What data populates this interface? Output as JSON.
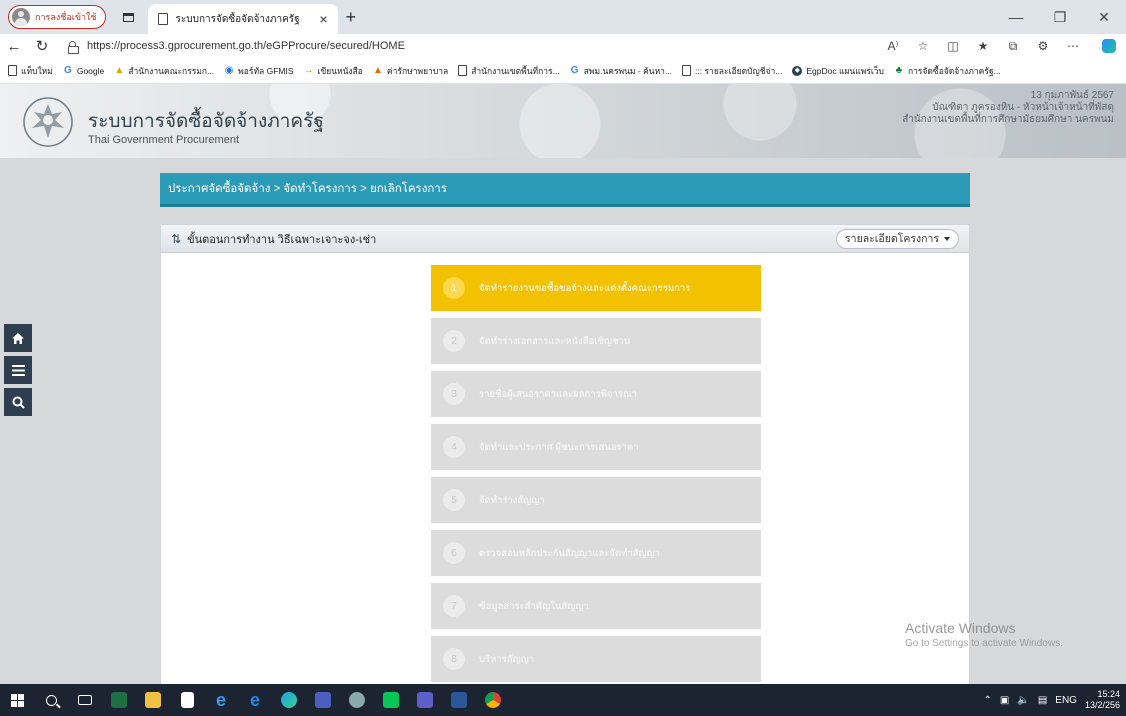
{
  "browser": {
    "profile_label": "การลงชื่อเข้าใช้",
    "tab_title": "ระบบการจัดซื้อจัดจ้างภาครัฐ",
    "url": "https://process3.gprocurement.go.th/eGPProcure/secured/HOME",
    "new_tab": "+",
    "tab_close": "×"
  },
  "bookmarks": [
    {
      "label": "แท็บใหม่",
      "icon": "folder"
    },
    {
      "label": "Google",
      "icon": "google-icon"
    },
    {
      "label": "สำนักงานคณะกรรมก...",
      "icon": "bookmark-icon"
    },
    {
      "label": "พอร์ทัล GFMIS",
      "icon": "gfmis-icon"
    },
    {
      "label": "เขียนหนังสือ",
      "icon": "bookmark-icon"
    },
    {
      "label": "ค่ารักษาพยาบาล",
      "icon": "bookmark-icon"
    },
    {
      "label": "สำนักงานเขตพื้นที่การ...",
      "icon": "folder"
    },
    {
      "label": "สพม.นครพนม - ค้นหา...",
      "icon": "google-icon"
    },
    {
      "label": "::: รายละเอียดบัญชีจ่า...",
      "icon": "folder"
    },
    {
      "label": "EgpDoc แผนแพร่เว็บ",
      "icon": "egpdoc-icon"
    },
    {
      "label": "การจัดซื้อจัดจ้างภาครัฐ...",
      "icon": "egp-icon"
    }
  ],
  "header": {
    "site_name": "ระบบการจัดซื้อจัดจ้างภาครัฐ",
    "site_sub": "Thai Government Procurement",
    "date": "13 กุมภาพันธ์ 2567",
    "user": "บัณฑิตา ภูครองหิน - หัวหน้าเจ้าหน้าที่พัสดุ",
    "office": "สำนักงานเขตพื้นที่การศึกษามัธยมศึกษา นครพนม"
  },
  "breadcrumb": "ประกาศจัดซื้อจัดจ้าง > จัดทำโครงการ > ยกเลิกโครงการ",
  "panel": {
    "title": "ขั้นตอนการทำงาน วิธีเฉพาะเจาะจง-เช่า",
    "detail_button": "รายละเอียดโครงการ"
  },
  "steps": [
    {
      "num": "1",
      "label": "จัดทำรายงานขอซื้อขอจ้างและแต่งตั้งคณะกรรมการ",
      "active": true
    },
    {
      "num": "2",
      "label": "จัดทำร่างเอกสารและหนังสือเชิญชวน",
      "active": false
    },
    {
      "num": "3",
      "label": "รายชื่อผู้เสนอราคาและผลการพิจารณา",
      "active": false
    },
    {
      "num": "4",
      "label": "จัดทำและประกาศ ผู้ชนะการเสนอราคา",
      "active": false
    },
    {
      "num": "5",
      "label": "จัดทำร่างสัญญา",
      "active": false
    },
    {
      "num": "6",
      "label": "ตรวจสอบหลักประกันสัญญาและจัดทำสัญญา",
      "active": false
    },
    {
      "num": "7",
      "label": "ข้อมูลสาระสำคัญในสัญญา",
      "active": false
    },
    {
      "num": "8",
      "label": "บริหารสัญญา",
      "active": false
    }
  ],
  "watermark": {
    "title": "Activate Windows",
    "sub": "Go to Settings to activate Windows."
  },
  "taskbar": {
    "lang": "ENG",
    "time": "15:24",
    "date": "13/2/256"
  },
  "colors": {
    "accent": "#2b9bb7",
    "active_step": "#f2c200",
    "side_nav": "#2e3d4f"
  }
}
